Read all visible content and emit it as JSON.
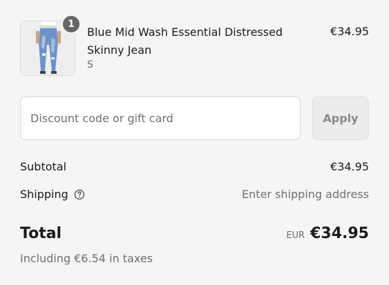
{
  "line_item": {
    "quantity": "1",
    "name": "Blue Mid Wash Essential Distressed Skinny Jean",
    "variant": "S",
    "price": "€34.95"
  },
  "discount": {
    "placeholder": "Discount code or gift card",
    "value": "",
    "apply_label": "Apply"
  },
  "summary": {
    "subtotal_label": "Subtotal",
    "subtotal_value": "€34.95",
    "shipping_label": "Shipping",
    "shipping_value": "Enter shipping address",
    "total_label": "Total",
    "currency_code": "EUR",
    "total_value": "€34.95",
    "taxes_note": "Including €6.54 in taxes"
  },
  "icons": {
    "help": "question-circle-icon",
    "product": "jeans-product-image"
  },
  "colors": {
    "background": "#f5f5f5",
    "badge": "#666666",
    "muted_text": "#707070",
    "apply_button_bg": "#ececec"
  }
}
